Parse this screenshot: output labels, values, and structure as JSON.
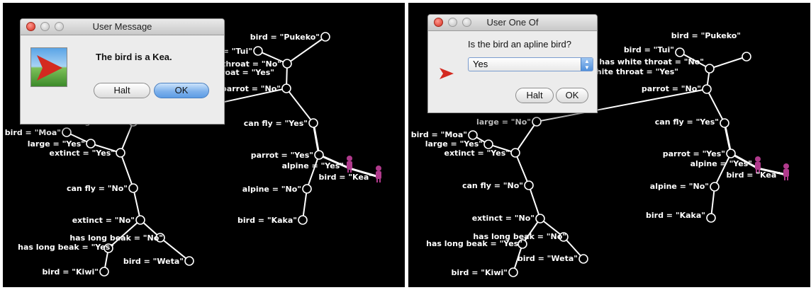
{
  "left_panel": {
    "dialog": {
      "title": "User Message",
      "message": "The bird is a Kea.",
      "icon": "red-arrow-flag-icon",
      "buttons": {
        "halt": "Halt",
        "ok": "OK"
      }
    },
    "graph_labels": {
      "pukeko": "bird = \"Pukeko\"",
      "tui": "d = \"Tui\"",
      "white_throat": "has white throat = \"No\"",
      "throat_yes": "throat = \"Yes\"",
      "parrot_no": "parrot = \"No\"",
      "can_fly_yes": "can fly = \"Yes\"",
      "parrot_yes": "parrot = \"Yes\"",
      "alpine_yes": "alpine = \"Yes\"",
      "kea": "bird = \"Kea\"",
      "alpine_no": "alpine = \"No\"",
      "kaka": "bird = \"Kaka\"",
      "large_no": "large = \"No\"",
      "moa": "bird = \"Moa\"",
      "large_yes": "large = \"Yes\"",
      "extinct_yes": "extinct = \"Yes\"",
      "can_fly_no": "can fly = \"No\"",
      "extinct_no": "extinct = \"No\"",
      "long_beak_no": "has long beak = \"No\"",
      "long_beak_yes": "has long beak = \"Yes\"",
      "weta": "bird = \"Weta\"",
      "kiwi": "bird = \"Kiwi\""
    }
  },
  "right_panel": {
    "dialog": {
      "title": "User One Of",
      "question": "Is the bird an apline bird?",
      "select_value": "Yes",
      "icon": "red-arrow-icon",
      "buttons": {
        "halt": "Halt",
        "ok": "OK"
      }
    },
    "graph_labels": {
      "pukeko": "bird = \"Pukeko\"",
      "tui": "bird = \"Tui\"",
      "white_throat": "has white throat = \"No\"",
      "throat_yes": "as white throat = \"Yes\"",
      "parrot_no": "parrot = \"No\"",
      "can_fly_yes": "can fly = \"Yes\"",
      "parrot_yes": "parrot = \"Yes\"",
      "alpine_yes": "alpine = \"Yes\"",
      "kea": "bird = \"Kea\"",
      "alpine_no": "alpine = \"No\"",
      "kaka": "bird = \"Kaka\"",
      "large_no": "large = \"No\"",
      "moa": "bird = \"Moa\"",
      "large_yes": "large = \"Yes\"",
      "extinct_yes": "extinct = \"Yes\"",
      "can_fly_no": "can fly = \"No\"",
      "extinct_no": "extinct = \"No\"",
      "long_beak_no": "has long beak = \"No\"",
      "long_beak_yes": "has long beak = \"Yes\"",
      "weta": "bird = \"Weta\"",
      "kiwi": "bird = \"Kiwi\""
    }
  },
  "colors": {
    "canvas": "#000000",
    "agent": "#b03a8c",
    "arrow": "#d42a20"
  }
}
